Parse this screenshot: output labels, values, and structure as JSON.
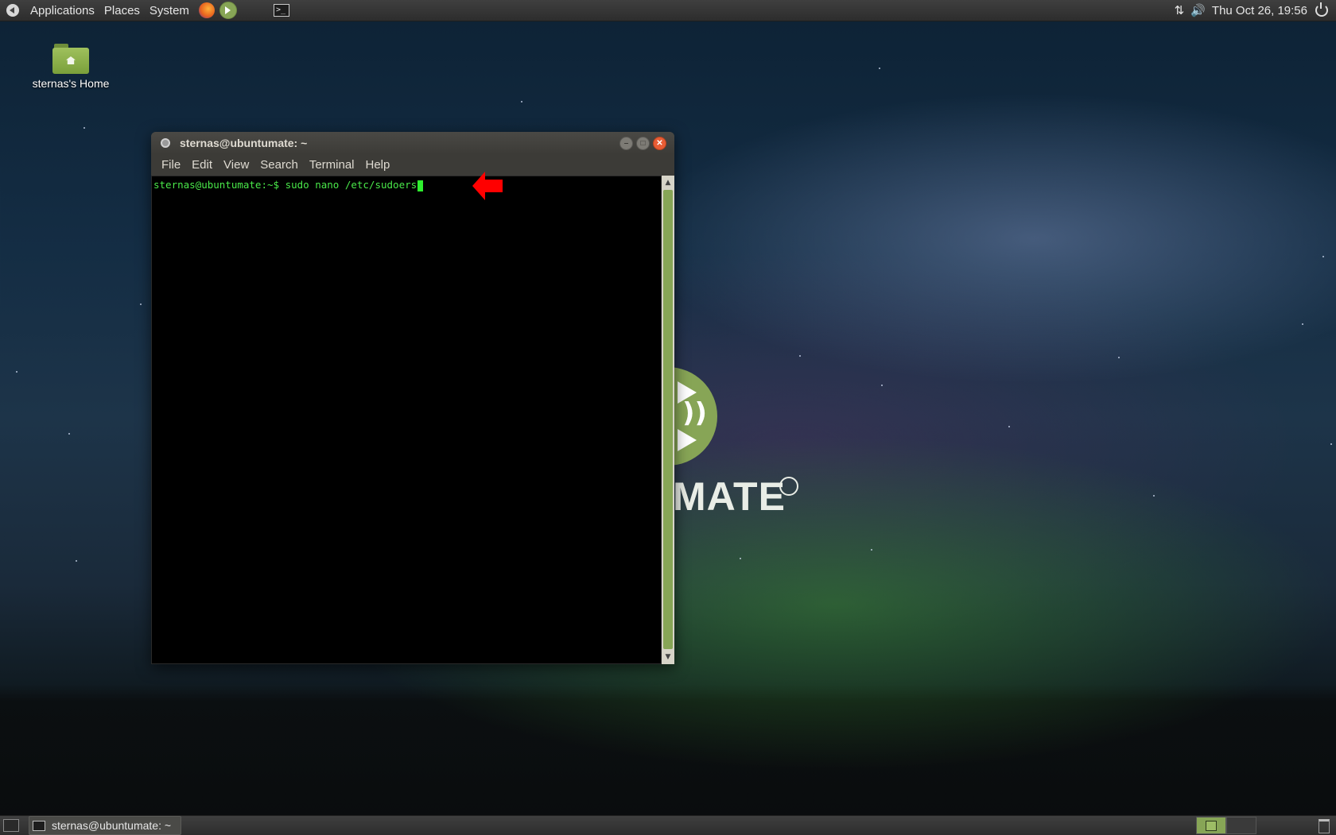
{
  "top_panel": {
    "menus": [
      "Applications",
      "Places",
      "System"
    ],
    "launchers": [
      "firefox-icon",
      "mate-welcome-icon",
      "terminal-icon"
    ],
    "tray": [
      "network-icon",
      "volume-icon"
    ],
    "clock": "Thu Oct 26, 19:56",
    "power": "power-icon"
  },
  "desktop": {
    "home_icon_label": "sternas's Home",
    "wallpaper_logo_text": "MATE"
  },
  "terminal": {
    "title": "sternas@ubuntumate: ~",
    "menu": [
      "File",
      "Edit",
      "View",
      "Search",
      "Terminal",
      "Help"
    ],
    "prompt": "sternas@ubuntumate:~$ ",
    "command": "sudo nano /etc/sudoers",
    "colors": {
      "text": "#4ae94a",
      "background": "#000000",
      "accent": "#87a556"
    }
  },
  "annotation": {
    "arrow_color": "#ff0000",
    "points_to": "command"
  },
  "bottom_panel": {
    "task_title": "sternas@ubuntumate: ~",
    "workspaces": [
      "active",
      "inactive"
    ]
  }
}
